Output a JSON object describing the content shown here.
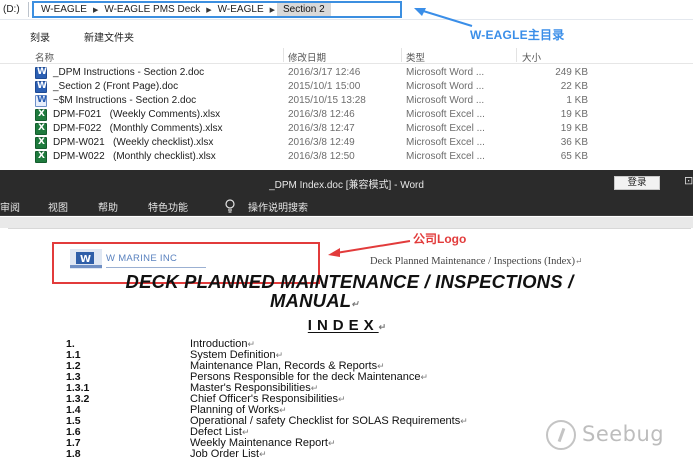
{
  "explorer": {
    "drive": "(D:)",
    "breadcrumbs": [
      "W-EAGLE",
      "W-EAGLE  PMS Deck",
      "W-EAGLE",
      "Section 2"
    ],
    "toolbar": {
      "burn": "刻录",
      "new_folder": "新建文件夹"
    },
    "columns": {
      "name": "名称",
      "date": "修改日期",
      "type": "类型",
      "size": "大小"
    },
    "files": [
      {
        "name": "_DPM Instructions - Section 2.doc",
        "date": "2016/3/17 12:46",
        "type": "Microsoft Word ...",
        "size": "249 KB",
        "icon": "word-doc-icon"
      },
      {
        "name": "_Section 2 (Front Page).doc",
        "date": "2015/10/1 15:00",
        "type": "Microsoft Word ...",
        "size": "22 KB",
        "icon": "word-doc-icon"
      },
      {
        "name": "~$M Instructions - Section 2.doc",
        "date": "2015/10/15 13:28",
        "type": "Microsoft Word ...",
        "size": "1 KB",
        "icon": "word-temp-icon"
      },
      {
        "name": "DPM-F021   (Weekly Comments).xlsx",
        "date": "2016/3/8 12:46",
        "type": "Microsoft Excel ...",
        "size": "19 KB",
        "icon": "excel-file-icon"
      },
      {
        "name": "DPM-F022   (Monthly Comments).xlsx",
        "date": "2016/3/8 12:47",
        "type": "Microsoft Excel ...",
        "size": "19 KB",
        "icon": "excel-file-icon"
      },
      {
        "name": "DPM-W021   (Weekly checklist).xlsx",
        "date": "2016/3/8 12:49",
        "type": "Microsoft Excel ...",
        "size": "36 KB",
        "icon": "excel-file-icon"
      },
      {
        "name": "DPM-W022   (Monthly checklist).xlsx",
        "date": "2016/3/8 12:50",
        "type": "Microsoft Excel ...",
        "size": "65 KB",
        "icon": "excel-file-icon"
      }
    ]
  },
  "annotations": {
    "main_dir": "W-EAGLE主目录",
    "company_logo": "公司Logo"
  },
  "word": {
    "title": "_DPM Index.doc [兼容模式]  -  Word",
    "login": "登录",
    "ribbon_tabs": [
      "审阅",
      "视图",
      "帮助",
      "特色功能",
      "操作说明搜索"
    ],
    "logo_text": "W MARINE INC",
    "header_right": "Deck Planned Maintenance / Inspections (Index)",
    "title_line1": "DECK PLANNED MAINTENANCE / INSPECTIONS /",
    "title_line2": "MANUAL",
    "index_heading": "INDEX",
    "para_mark": "↵",
    "toc": [
      {
        "num": "1.",
        "text": "Introduction"
      },
      {
        "num": "1.1",
        "text": "System Definition"
      },
      {
        "num": "1.2",
        "text": "Maintenance Plan, Records & Reports"
      },
      {
        "num": "1.3",
        "text": "Persons Responsible for the deck Maintenance"
      },
      {
        "num": "1.3.1",
        "text": "Master's Responsibilities"
      },
      {
        "num": "1.3.2",
        "text": "Chief Officer's Responsibilities"
      },
      {
        "num": "1.4",
        "text": "Planning of Works"
      },
      {
        "num": "1.5",
        "text": "Operational / safety Checklist for SOLAS Requirements"
      },
      {
        "num": "1.6",
        "text": "Defect List"
      },
      {
        "num": "1.7",
        "text": "Weekly Maintenance Report"
      },
      {
        "num": "1.8",
        "text": "Job Order List"
      }
    ]
  },
  "watermark": "Seebug",
  "colors": {
    "annotation_blue": "#3a8ee8",
    "annotation_red": "#e23b3b",
    "word_dark": "#2b2b2b"
  }
}
